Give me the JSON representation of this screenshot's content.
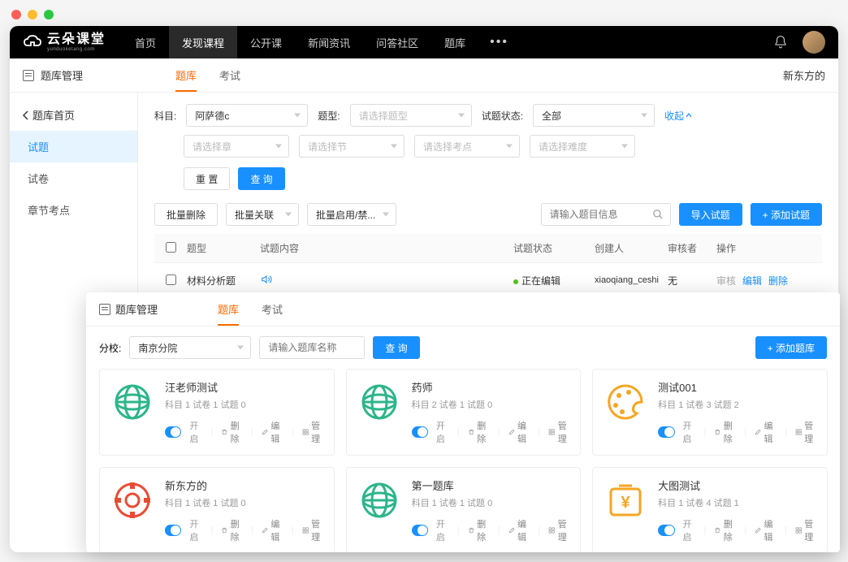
{
  "logo": {
    "title": "云朵课堂",
    "sub": "yunduoketang.com"
  },
  "nav": {
    "items": [
      "首页",
      "发现课程",
      "公开课",
      "新闻资讯",
      "问答社区",
      "题库"
    ],
    "active_index": 1
  },
  "subbar": {
    "title": "题库管理",
    "tabs": [
      "题库",
      "考试"
    ],
    "active_tab": 0,
    "right_text": "新东方的"
  },
  "sidebar": {
    "back": "题库首页",
    "items": [
      "试题",
      "试卷",
      "章节考点"
    ],
    "active_index": 0
  },
  "filters": {
    "subject_label": "科目:",
    "subject_value": "阿萨德c",
    "type_label": "题型:",
    "type_placeholder": "请选择题型",
    "status_label": "试题状态:",
    "status_value": "全部",
    "collapse": "收起",
    "chapter_placeholder": "请选择章",
    "section_placeholder": "请选择节",
    "point_placeholder": "请选择考点",
    "difficulty_placeholder": "请选择难度",
    "reset": "重 置",
    "search": "查 询"
  },
  "actions": {
    "batch_delete": "批量删除",
    "batch_relate": "批量关联",
    "batch_toggle": "批量启用/禁...",
    "search_placeholder": "请输入题目信息",
    "import": "导入试题",
    "add": "+ 添加试题"
  },
  "table": {
    "headers": {
      "type": "题型",
      "content": "试题内容",
      "status": "试题状态",
      "creator": "创建人",
      "reviewer": "审核者",
      "ops": "操作"
    },
    "rows": [
      {
        "type": "材料分析题",
        "has_audio": true,
        "status": "正在编辑",
        "creator": "xiaoqiang_ceshi",
        "reviewer": "无",
        "ops": {
          "review": "审核",
          "edit": "编辑",
          "delete": "删除"
        }
      }
    ]
  },
  "window2": {
    "title": "题库管理",
    "tabs": [
      "题库",
      "考试"
    ],
    "active_tab": 0,
    "branch_label": "分校:",
    "branch_value": "南京分院",
    "name_placeholder": "请输入题库名称",
    "search": "查 询",
    "add": "+ 添加题库",
    "cards": [
      {
        "title": "汪老师测试",
        "meta": "科目 1  试卷 1  试题 0",
        "icon": "globe-green"
      },
      {
        "title": "药师",
        "meta": "科目 2  试卷 1  试题 0",
        "icon": "globe-green"
      },
      {
        "title": "测试001",
        "meta": "科目 1  试卷 3  试题 2",
        "icon": "palette-orange"
      },
      {
        "title": "新东方的",
        "meta": "科目 1  试卷 1  试题 0",
        "icon": "coin-red"
      },
      {
        "title": "第一题库",
        "meta": "科目 1  试卷 1  试题 0",
        "icon": "globe-green"
      },
      {
        "title": "大图测试",
        "meta": "科目 1  试卷 4  试题 1",
        "icon": "yuan-orange"
      }
    ],
    "card_ops": {
      "on": "开启",
      "delete": "删除",
      "edit": "编辑",
      "manage": "管理"
    }
  }
}
